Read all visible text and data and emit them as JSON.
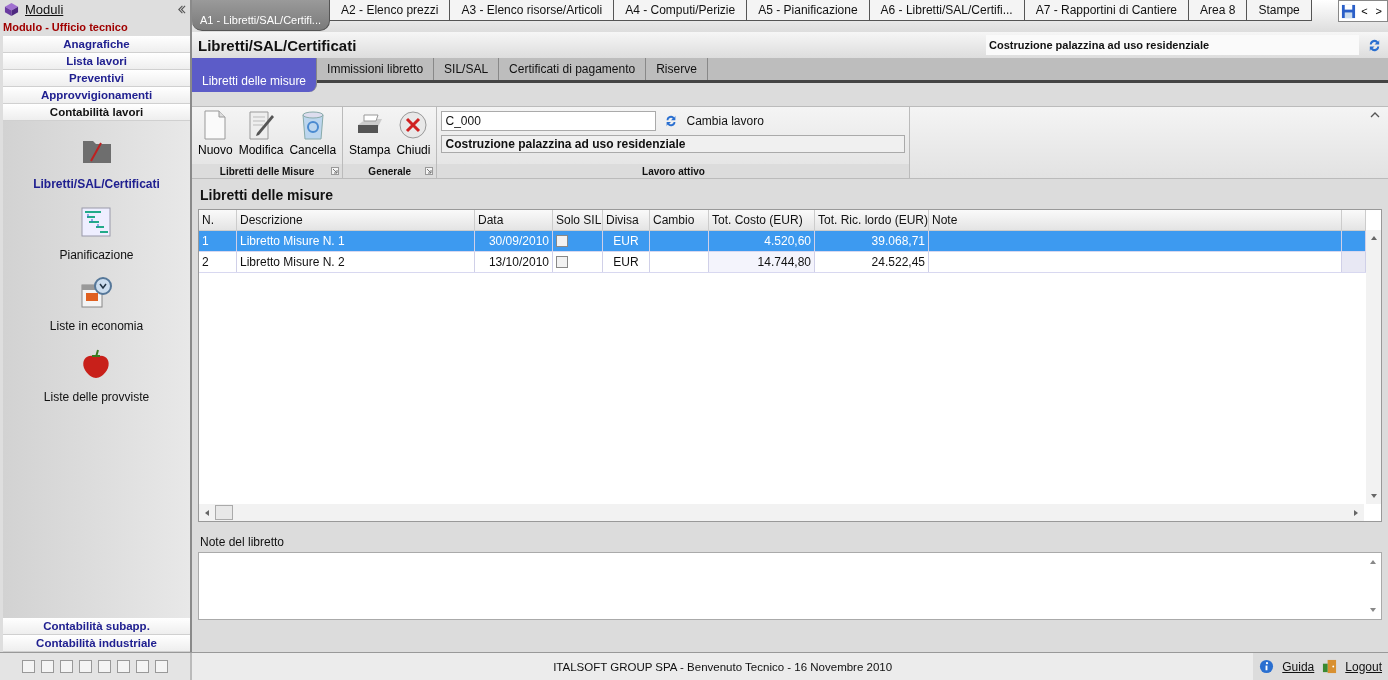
{
  "sidebar": {
    "title": "Moduli",
    "module": "Modulo - Ufficio tecnico",
    "nav_top": [
      {
        "label": "Anagrafiche",
        "selected": false
      },
      {
        "label": "Lista lavori",
        "selected": false
      },
      {
        "label": "Preventivi",
        "selected": false
      },
      {
        "label": "Approvvigionamenti",
        "selected": false
      },
      {
        "label": "Contabilità lavori",
        "selected": true
      }
    ],
    "apps": [
      {
        "label": "Libretti/SAL/Certificati",
        "kind": "folder",
        "selected": true
      },
      {
        "label": "Pianificazione",
        "kind": "gantt",
        "selected": false
      },
      {
        "label": "Liste in economia",
        "kind": "calendar",
        "selected": false
      },
      {
        "label": "Liste delle provviste",
        "kind": "fruit",
        "selected": false
      }
    ],
    "nav_bottom": [
      {
        "label": "Contabilità subapp.",
        "selected": false
      },
      {
        "label": "Contabilità industriale",
        "selected": false
      }
    ]
  },
  "doc_tabs": [
    {
      "label": "A1 - Libretti/SAL/Certifi...",
      "selected": true
    },
    {
      "label": "A2 - Elenco prezzi",
      "selected": false
    },
    {
      "label": "A3 - Elenco risorse/Articoli",
      "selected": false
    },
    {
      "label": "A4 - Computi/Perizie",
      "selected": false
    },
    {
      "label": "A5 - Pianificazione",
      "selected": false
    },
    {
      "label": "A6 - Libretti/SAL/Certifi...",
      "selected": false
    },
    {
      "label": "A7 - Rapportini di Cantiere",
      "selected": false
    },
    {
      "label": "Area 8",
      "selected": false
    },
    {
      "label": "Stampe",
      "selected": false
    }
  ],
  "tab_nav": [
    "<",
    ">"
  ],
  "page": {
    "title": "Libretti/SAL/Certificati",
    "project": "Costruzione palazzina ad uso residenziale"
  },
  "sub_tabs": [
    {
      "label": "Libretti delle misure",
      "selected": true
    },
    {
      "label": "Immissioni libretto",
      "selected": false
    },
    {
      "label": "SIL/SAL",
      "selected": false
    },
    {
      "label": "Certificati di pagamento",
      "selected": false
    },
    {
      "label": "Riserve",
      "selected": false
    }
  ],
  "ribbon": {
    "groups": [
      {
        "label": "Libretti delle Misure",
        "buttons": [
          {
            "label": "Nuovo",
            "kind": "new"
          },
          {
            "label": "Modifica",
            "kind": "edit"
          },
          {
            "label": "Cancella",
            "kind": "bin"
          }
        ]
      },
      {
        "label": "Generale",
        "buttons": [
          {
            "label": "Stampa",
            "kind": "print"
          },
          {
            "label": "Chiudi",
            "kind": "close"
          }
        ]
      }
    ],
    "job": {
      "label": "Lavoro attivo",
      "code": "C_000",
      "change": "Cambia lavoro",
      "description": "Costruzione palazzina ad uso residenziale"
    }
  },
  "table": {
    "title": "Libretti delle misure",
    "columns": [
      "N.",
      "Descrizione",
      "Data",
      "Solo SIL",
      "Divisa",
      "Cambio",
      "Tot. Costo (EUR)",
      "Tot. Ric. lordo (EUR)",
      "Note"
    ],
    "rows": [
      {
        "n": "1",
        "description": "Libretto Misure N. 1",
        "date": "30/09/2010",
        "solo_sil": false,
        "currency": "EUR",
        "cost": "4.520,60",
        "gross": "39.068,71",
        "selected": true
      },
      {
        "n": "2",
        "description": "Libretto Misure N. 2",
        "date": "13/10/2010",
        "solo_sil": false,
        "currency": "EUR",
        "cost": "14.744,80",
        "gross": "24.522,45",
        "selected": false
      }
    ]
  },
  "notes": {
    "label": "Note del libretto"
  },
  "status_bar": {
    "text": "ITALSOFT GROUP SPA - Benvenuto Tecnico - 16 Novembre 2010",
    "help": "Guida",
    "logout": "Logout"
  }
}
